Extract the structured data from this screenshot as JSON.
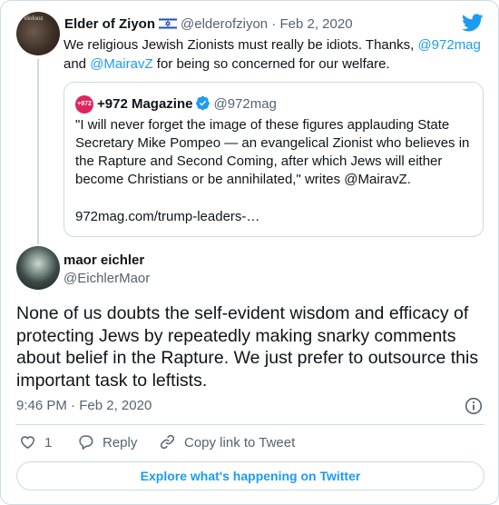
{
  "parent_tweet": {
    "name": "Elder of Ziyon",
    "flag_icon": "israel-flag-icon",
    "handle": "@elderofziyon",
    "separator": "·",
    "date": "Feb 2, 2020",
    "text_pre": "We religious Jewish Zionists must really be idiots. Thanks, ",
    "mention1": "@972mag",
    "text_mid": "and ",
    "mention2": "@MairavZ",
    "text_post": " for being so concerned for our welfare.",
    "quote": {
      "logo_text": "+972",
      "name": "+972 Magazine",
      "verified_icon": "verified-badge-icon",
      "handle": "@972mag",
      "text": "\"I will never forget the image of these figures applauding State Secretary Mike Pompeo — an evangelical Zionist who believes in the Rapture and Second Coming, after which Jews will either become Christians or be annihilated,\" writes @MairavZ.",
      "link": "972mag.com/trump-leaders-…"
    }
  },
  "main_tweet": {
    "name": "maor eichler",
    "handle": "@EichlerMaor",
    "text": "None of us doubts the self-evident wisdom and efficacy of protecting Jews by repeatedly making snarky comments about belief in the Rapture. We just prefer to outsource this important task to leftists.",
    "time": "9:46 PM",
    "separator": "·",
    "date": "Feb 2, 2020"
  },
  "actions": {
    "like_count": "1",
    "reply_label": "Reply",
    "copy_label": "Copy link to Tweet"
  },
  "explore_label": "Explore what's happening on Twitter",
  "colors": {
    "accent": "#1d9bf0",
    "muted": "#536471",
    "border": "#cfd9de",
    "brand_972": "#e0245e"
  }
}
